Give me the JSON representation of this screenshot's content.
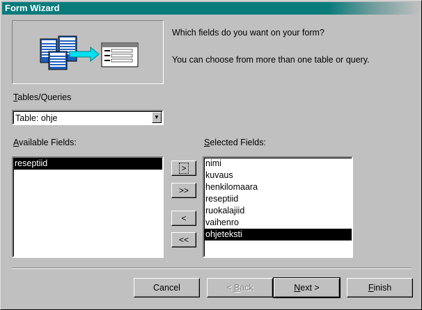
{
  "window": {
    "title": "Form Wizard"
  },
  "header": {
    "question": "Which fields do you want on your form?",
    "hint": "You can choose from more than one table or query."
  },
  "tables_queries": {
    "label_first": "T",
    "label_rest": "ables/Queries",
    "selected": "Table: ohje"
  },
  "available": {
    "label_first": "A",
    "label_rest": "vailable Fields:",
    "items": [
      "reseptiid"
    ],
    "selected_index": 0
  },
  "selected": {
    "label_first": "S",
    "label_rest": "elected Fields:",
    "items": [
      "nimi",
      "kuvaus",
      "henkilomaara",
      "reseptiid",
      "ruokalajiid",
      "vaihenro",
      "ohjeteksti"
    ],
    "selected_index": 6
  },
  "move_buttons": {
    "add_one": ">",
    "add_all": ">>",
    "remove_one": "<",
    "remove_all": "<<"
  },
  "actions": {
    "cancel": "Cancel",
    "back_prefix": "< ",
    "back_first": "B",
    "back_rest": "ack",
    "next_first": "N",
    "next_rest": "ext >",
    "finish_first": "F",
    "finish_rest": "inish"
  }
}
